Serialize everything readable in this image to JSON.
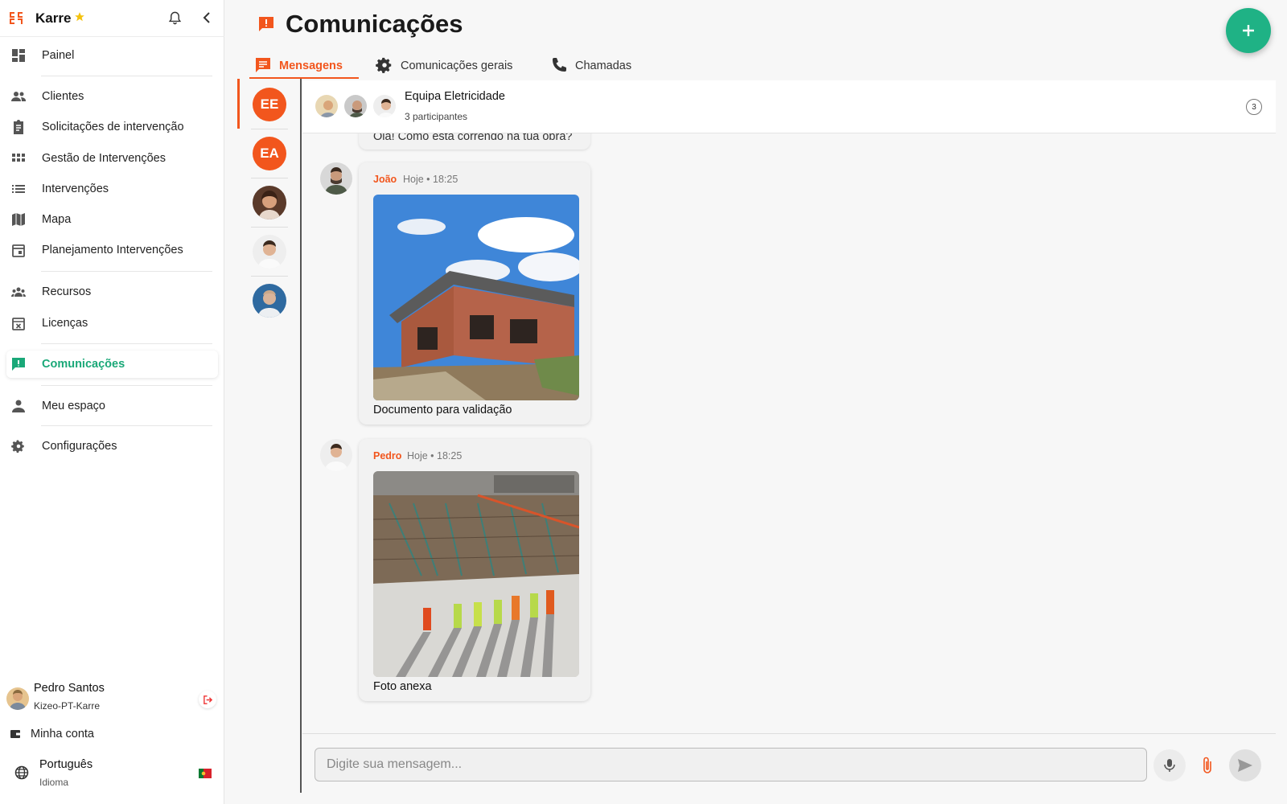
{
  "brand": {
    "name": "Karre",
    "logo_icon": "karre-logo-icon",
    "star_icon": "star-icon",
    "accent": "#f2561d"
  },
  "sidebar": {
    "items": [
      {
        "label": "Painel",
        "icon": "dashboard-icon"
      },
      {
        "label": "Clientes",
        "icon": "people-icon"
      },
      {
        "label": "Solicitações de intervenção",
        "icon": "clipboard-icon"
      },
      {
        "label": "Gestão de Intervenções",
        "icon": "grid-icon"
      },
      {
        "label": "Intervenções",
        "icon": "list-icon"
      },
      {
        "label": "Mapa",
        "icon": "map-icon"
      },
      {
        "label": "Planejamento Intervenções",
        "icon": "calendar-icon"
      },
      {
        "label": "Recursos",
        "icon": "groups-icon"
      },
      {
        "label": "Licenças",
        "icon": "calendar-x-icon"
      },
      {
        "label": "Comunicações",
        "icon": "feedback-icon",
        "active": true
      },
      {
        "label": "Meu espaço",
        "icon": "person-icon"
      },
      {
        "label": "Configurações",
        "icon": "gear-icon"
      }
    ],
    "active_color": "#1aa878",
    "user": {
      "name": "Pedro Santos",
      "org": "Kizeo-PT-Karre"
    },
    "account_label": "Minha conta",
    "language": {
      "name": "Português",
      "sub": "Idioma"
    }
  },
  "page": {
    "title": "Comunicações",
    "icon": "feedback-icon",
    "fab_color": "#1fb285"
  },
  "tabs": [
    {
      "label": "Mensagens",
      "icon": "chat-icon",
      "active": true
    },
    {
      "label": "Comunicações gerais",
      "icon": "gear-icon"
    },
    {
      "label": "Chamadas",
      "icon": "phone-icon"
    }
  ],
  "conversations": [
    {
      "initials": "EE",
      "color": "#f2561d",
      "active": true
    },
    {
      "initials": "EA",
      "color": "#f2561d"
    },
    {
      "initials": "",
      "avatar": "woman-avatar"
    },
    {
      "initials": "",
      "avatar": "man-avatar"
    },
    {
      "initials": "",
      "avatar": "man-blue-avatar"
    }
  ],
  "chat": {
    "name": "Equipa Eletricidade",
    "participants_label": "3 participantes",
    "count": "3",
    "previous_message": "Olá! Como está correndo na tua obra?",
    "messages": [
      {
        "author": "João",
        "time": "Hoje • 18:25",
        "caption": "Documento para validação",
        "image": "house-construction-photo"
      },
      {
        "author": "Pedro",
        "time": "Hoje • 18:25",
        "caption": "Foto anexa",
        "image": "construction-site-workers-photo"
      }
    ],
    "composer_placeholder": "Digite sua mensagem..."
  }
}
